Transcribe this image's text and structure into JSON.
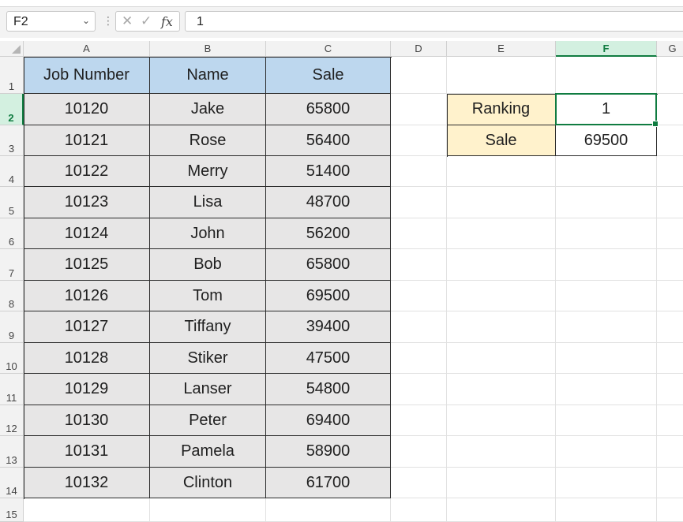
{
  "formula_bar": {
    "name_box": "F2",
    "separator": "⋮",
    "cancel_icon": "✕",
    "enter_icon": "✓",
    "fx_label": "fx",
    "formula": "1"
  },
  "sheet": {
    "columns": [
      "A",
      "B",
      "C",
      "D",
      "E",
      "F",
      "G"
    ],
    "rows": [
      "1",
      "2",
      "3",
      "4",
      "5",
      "6",
      "7",
      "8",
      "9",
      "10",
      "11",
      "12",
      "13",
      "14",
      "15"
    ],
    "selected_cell": "F2"
  },
  "table": {
    "headers": [
      "Job Number",
      "Name",
      "Sale"
    ],
    "rows": [
      [
        "10120",
        "Jake",
        "65800"
      ],
      [
        "10121",
        "Rose",
        "56400"
      ],
      [
        "10122",
        "Merry",
        "51400"
      ],
      [
        "10123",
        "Lisa",
        "48700"
      ],
      [
        "10124",
        "John",
        "56200"
      ],
      [
        "10125",
        "Bob",
        "65800"
      ],
      [
        "10126",
        "Tom",
        "69500"
      ],
      [
        "10127",
        "Tiffany",
        "39400"
      ],
      [
        "10128",
        "Stiker",
        "47500"
      ],
      [
        "10129",
        "Lanser",
        "54800"
      ],
      [
        "10130",
        "Peter",
        "69400"
      ],
      [
        "10131",
        "Pamela",
        "58900"
      ],
      [
        "10132",
        "Clinton",
        "61700"
      ]
    ]
  },
  "lookup": {
    "ranking_label": "Ranking",
    "ranking_value": "1",
    "sale_label": "Sale",
    "sale_value": "69500"
  },
  "colors": {
    "header_fill": "#bdd7ee",
    "body_fill": "#e7e6e6",
    "label_fill": "#fff2cc",
    "selection": "#107c41"
  }
}
